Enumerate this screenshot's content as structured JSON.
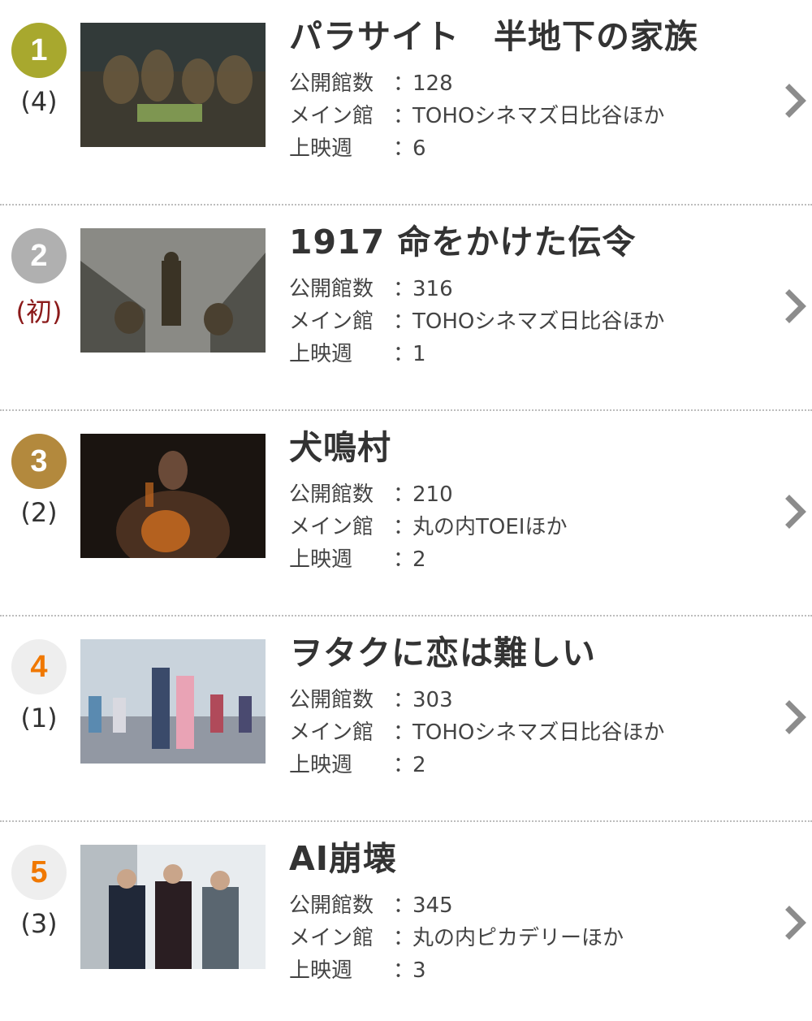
{
  "labels": {
    "theaters": "公開館数",
    "main_theater": "メイン館",
    "weeks": "上映週",
    "colon": "："
  },
  "items": [
    {
      "rank": "1",
      "prev": "(4)",
      "badge_color": "#a8a82e",
      "badge_text_color": "#ffffff",
      "prev_is_new": false,
      "title": "パラサイト　半地下の家族",
      "theaters": "128",
      "main_theater": "TOHOシネマズ日比谷ほか",
      "weeks": "6",
      "thumb_palette": [
        "#3d3a30",
        "#6d5b3f",
        "#2b3b40"
      ]
    },
    {
      "rank": "2",
      "prev": "(初)",
      "badge_color": "#b0b0b0",
      "badge_text_color": "#ffffff",
      "prev_is_new": true,
      "title": "1917 命をかけた伝令",
      "theaters": "316",
      "main_theater": "TOHOシネマズ日比谷ほか",
      "weeks": "1",
      "thumb_palette": [
        "#8a8a85",
        "#4a4a45",
        "#b5b3ad"
      ]
    },
    {
      "rank": "3",
      "prev": "(2)",
      "badge_color": "#b3893d",
      "badge_text_color": "#ffffff",
      "prev_is_new": false,
      "title": "犬鳴村",
      "theaters": "210",
      "main_theater": "丸の内TOEIほか",
      "weeks": "2",
      "thumb_palette": [
        "#1a1410",
        "#c76a20",
        "#4a3020"
      ]
    },
    {
      "rank": "4",
      "prev": "(1)",
      "badge_color": "#eeeeee",
      "badge_text_color": "#f07800",
      "prev_is_new": false,
      "title": "ヲタクに恋は難しい",
      "theaters": "303",
      "main_theater": "TOHOシネマズ日比谷ほか",
      "weeks": "2",
      "thumb_palette": [
        "#c9d3dc",
        "#7a7f8a",
        "#3a4a6a"
      ]
    },
    {
      "rank": "5",
      "prev": "(3)",
      "badge_color": "#eeeeee",
      "badge_text_color": "#f07800",
      "prev_is_new": false,
      "title": "AI崩壊",
      "theaters": "345",
      "main_theater": "丸の内ピカデリーほか",
      "weeks": "3",
      "thumb_palette": [
        "#e8ecef",
        "#202838",
        "#5a6670"
      ]
    }
  ],
  "icons": {
    "chevron": "chevron-right-icon"
  },
  "colors": {
    "chevron": "#8c8c8c",
    "divider": "#bdbdbd"
  }
}
